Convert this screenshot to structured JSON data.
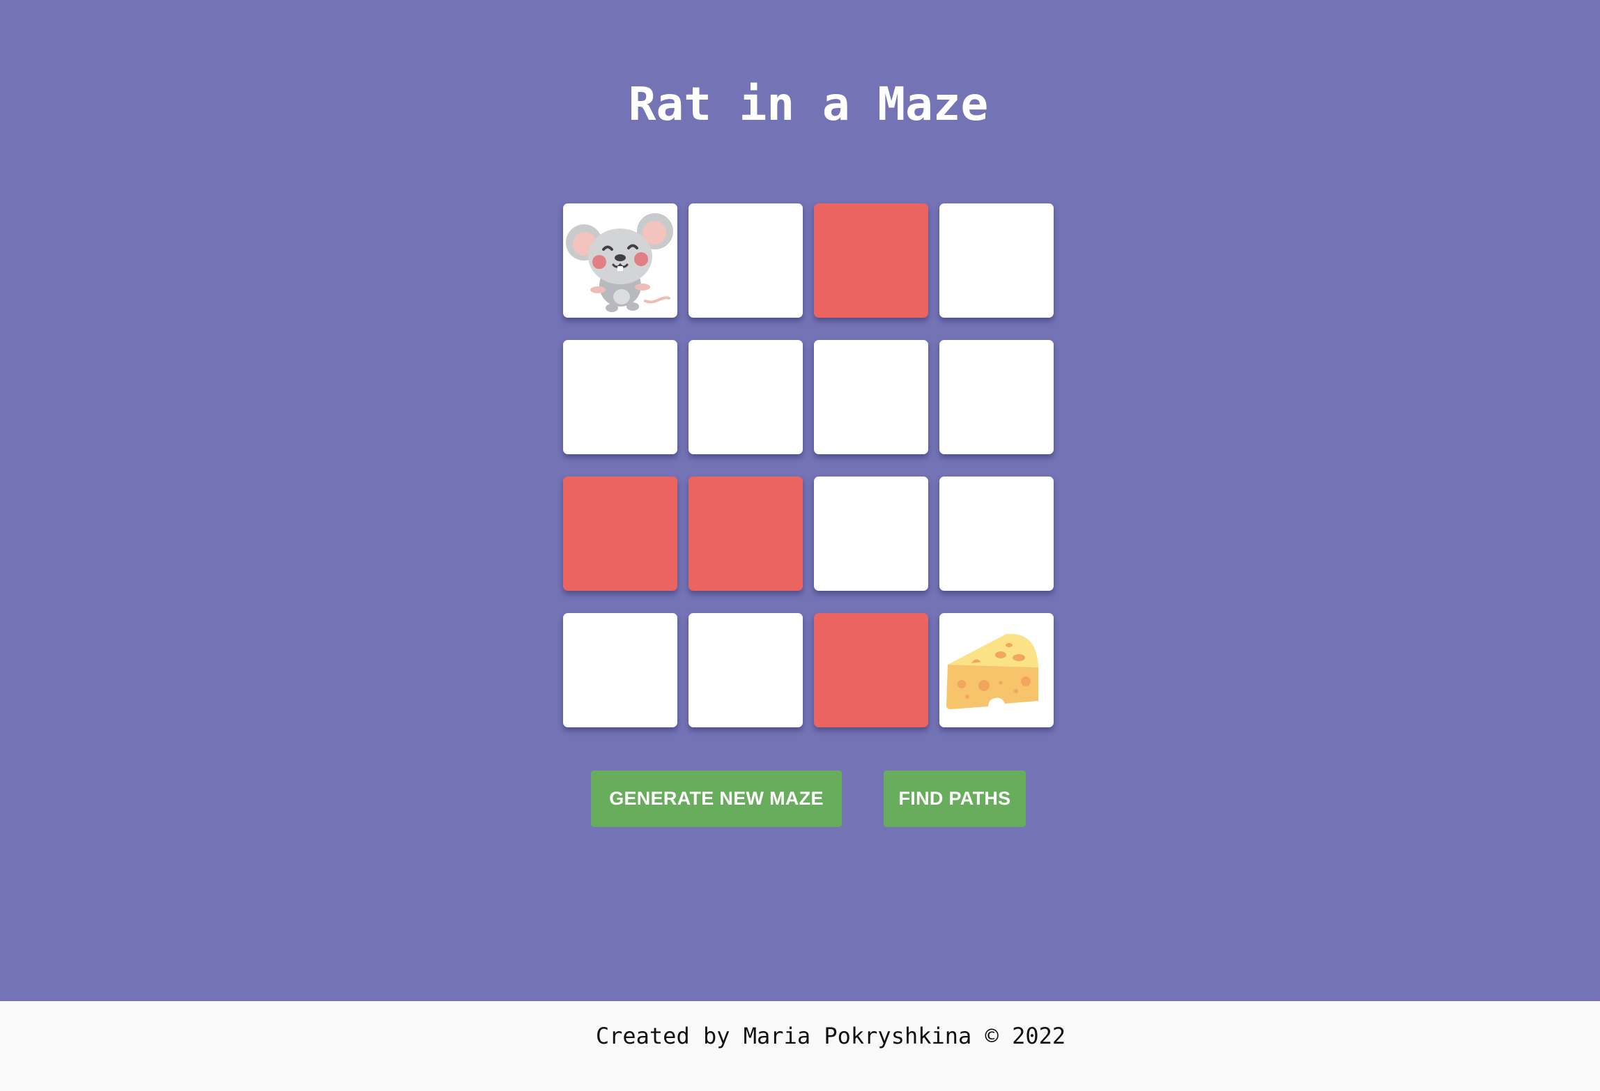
{
  "app": {
    "title": "Rat in a Maze"
  },
  "maze": {
    "rows": 4,
    "cols": 4,
    "start": [
      0,
      0
    ],
    "goal": [
      3,
      3
    ],
    "start_icon": "mouse-icon",
    "goal_icon": "cheese-icon",
    "cells": [
      [
        "start",
        "open",
        "wall",
        "open"
      ],
      [
        "open",
        "open",
        "open",
        "open"
      ],
      [
        "wall",
        "wall",
        "open",
        "open"
      ],
      [
        "open",
        "open",
        "wall",
        "goal"
      ]
    ],
    "colors": {
      "background": "#7373b5",
      "open": "#ffffff",
      "wall": "#eb645f"
    }
  },
  "buttons": {
    "generate_label": "GENERATE NEW MAZE",
    "find_label": "FIND PATHS",
    "color": "#67ad5b"
  },
  "footer": {
    "text": "Created by Maria Pokryshkina © 2022"
  }
}
